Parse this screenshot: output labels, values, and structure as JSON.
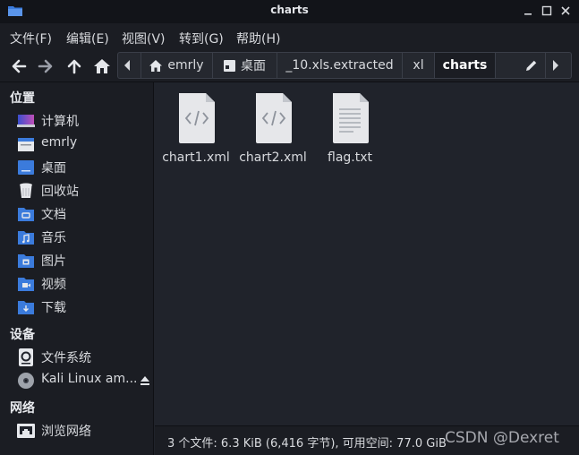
{
  "window": {
    "title": "charts"
  },
  "menu": [
    {
      "label": "文件(F)"
    },
    {
      "label": "编辑(E)"
    },
    {
      "label": "视图(V)"
    },
    {
      "label": "转到(G)"
    },
    {
      "label": "帮助(H)"
    }
  ],
  "toolbar": {
    "back_icon": "arrow-left-icon",
    "forward_icon": "arrow-right-icon",
    "up_icon": "arrow-up-icon",
    "home_icon": "home-icon"
  },
  "breadcrumbs": [
    {
      "label": "emrly",
      "icon": "home-icon"
    },
    {
      "label": "桌面",
      "icon": "desktop-icon"
    },
    {
      "label": "_10.xls.extracted"
    },
    {
      "label": "xl"
    },
    {
      "label": "charts",
      "active": true
    },
    {
      "label": ""
    }
  ],
  "sidebar": {
    "places_heading": "位置",
    "places": [
      {
        "label": "计算机",
        "icon": "computer-icon"
      },
      {
        "label": "emrly",
        "icon": "home-folder-icon"
      },
      {
        "label": "桌面",
        "icon": "desktop-folder-icon"
      },
      {
        "label": "回收站",
        "icon": "trash-icon"
      },
      {
        "label": "文档",
        "icon": "documents-folder-icon"
      },
      {
        "label": "音乐",
        "icon": "music-folder-icon"
      },
      {
        "label": "图片",
        "icon": "pictures-folder-icon"
      },
      {
        "label": "视频",
        "icon": "videos-folder-icon"
      },
      {
        "label": "下载",
        "icon": "downloads-folder-icon"
      }
    ],
    "devices_heading": "设备",
    "devices": [
      {
        "label": "文件系统",
        "icon": "drive-icon"
      },
      {
        "label": "Kali Linux am...",
        "icon": "disc-icon",
        "eject_icon": "eject-icon"
      }
    ],
    "network_heading": "网络",
    "network": [
      {
        "label": "浏览网络",
        "icon": "network-icon"
      }
    ]
  },
  "files": [
    {
      "name": "chart1.xml",
      "icon": "xml-file-icon"
    },
    {
      "name": "chart2.xml",
      "icon": "xml-file-icon"
    },
    {
      "name": "flag.txt",
      "icon": "text-file-icon"
    }
  ],
  "status": {
    "text": "3 个文件: 6.3 KiB (6,416 字节), 可用空间: 77.0 GiB"
  },
  "watermark": {
    "text": "CSDN @Dexret"
  },
  "colors": {
    "folder_blue": "#3b7bdc",
    "window_bg": "#20232b",
    "sidebar_bg": "#1b1d23"
  }
}
